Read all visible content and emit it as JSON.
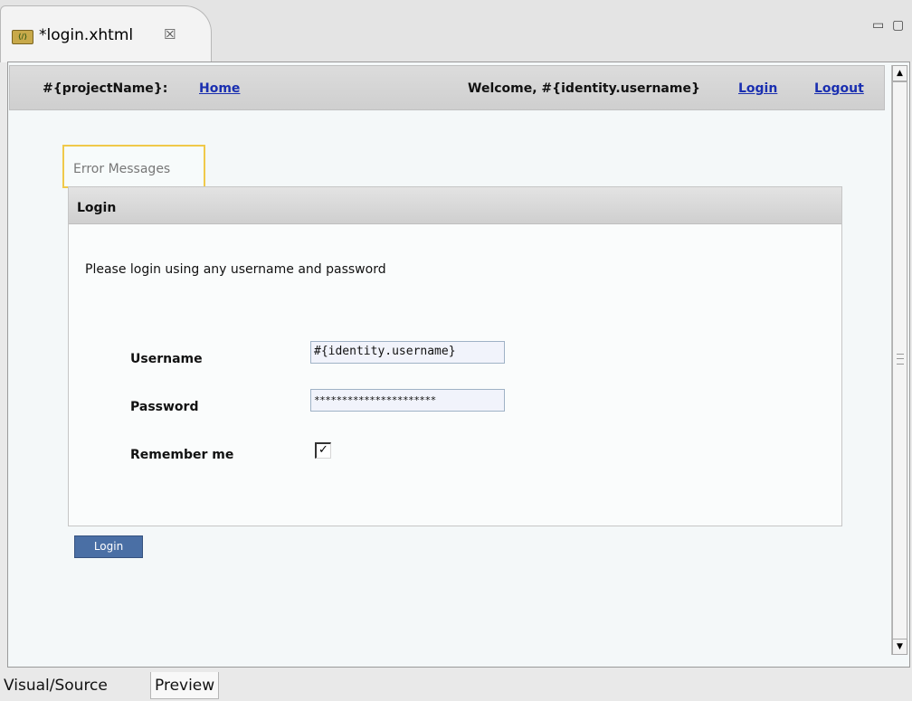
{
  "editor_tab": {
    "icon": "xhtml-file-icon",
    "title": "*login.xhtml",
    "close_glyph": "☒"
  },
  "window_controls": {
    "minimize": "▭",
    "maximize": "▢"
  },
  "page_header": {
    "project": "#{projectName}:",
    "home_link": "Home",
    "welcome": "Welcome, #{identity.username}",
    "login_link": "Login",
    "logout_link": "Logout"
  },
  "error_messages": "Error Messages",
  "login_panel": {
    "title": "Login",
    "intro": "Please login using any username and password",
    "username_label": "Username",
    "username_value": "#{identity.username}",
    "password_label": "Password",
    "password_value": "**********************",
    "remember_label": "Remember me",
    "remember_checked": true,
    "remember_glyph": "✓"
  },
  "login_button": "Login",
  "bottom_tabs": [
    {
      "label": "Visual/Source",
      "active": false
    },
    {
      "label": "Preview",
      "active": true
    }
  ],
  "scrollbar": {
    "up_glyph": "▲",
    "down_glyph": "▼"
  }
}
